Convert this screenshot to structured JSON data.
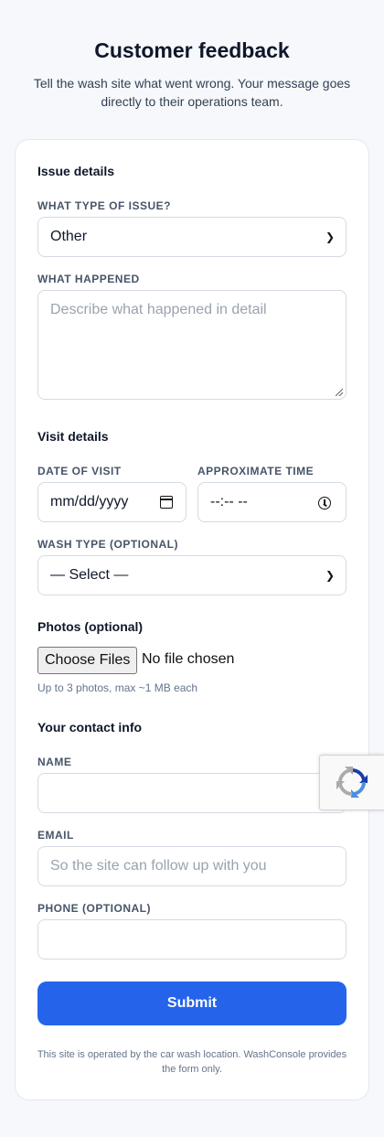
{
  "header": {
    "title": "Customer feedback",
    "subtitle": "Tell the wash site what went wrong. Your message goes directly to their operations team."
  },
  "issue": {
    "section_title": "Issue details",
    "type_label": "WHAT TYPE OF ISSUE?",
    "type_value": "Other",
    "happened_label": "WHAT HAPPENED",
    "happened_placeholder": "Describe what happened in detail"
  },
  "visit": {
    "section_title": "Visit details",
    "date_label": "DATE OF VISIT",
    "date_value": "mm/dd/yyyy",
    "time_label": "APPROXIMATE TIME",
    "time_value": "--:-- --",
    "wash_label": "WASH TYPE (OPTIONAL)",
    "wash_value": "— Select —"
  },
  "photos": {
    "section_title": "Photos (optional)",
    "button_label": "Choose Files",
    "status": "No file chosen",
    "hint": "Up to 3 photos, max ~1 MB each"
  },
  "contact": {
    "section_title": "Your contact info",
    "name_label": "NAME",
    "name_value": "",
    "email_label": "EMAIL",
    "email_placeholder": "So the site can follow up with you",
    "phone_label": "PHONE (OPTIONAL)",
    "phone_value": ""
  },
  "submit_label": "Submit",
  "footer": "This site is operated by the car wash location. WashConsole provides the form only.",
  "colors": {
    "accent": "#2563eb",
    "background": "#f6f8fb",
    "card": "#ffffff"
  },
  "icons": {
    "date": "calendar-icon",
    "time": "clock-icon",
    "captcha": "recaptcha-icon"
  }
}
